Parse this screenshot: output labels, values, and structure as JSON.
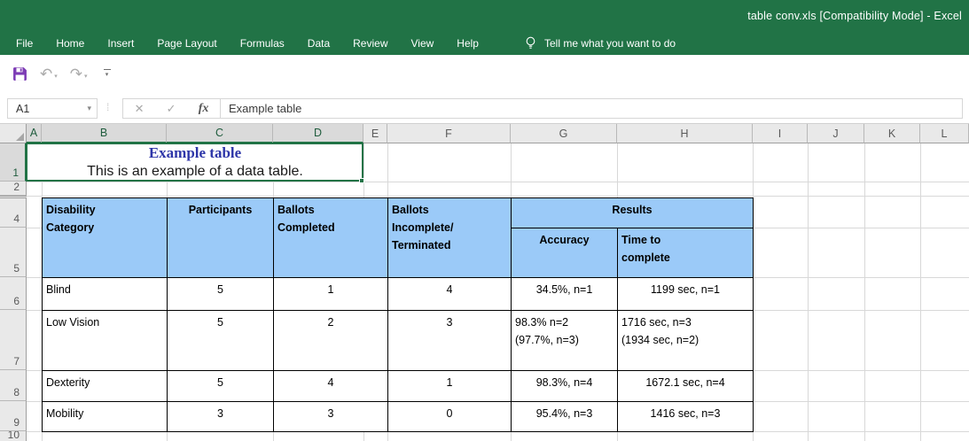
{
  "titlebar": {
    "title": "table conv.xls  [Compatibility Mode]  -  Excel"
  },
  "ribbon": {
    "tabs": [
      "File",
      "Home",
      "Insert",
      "Page Layout",
      "Formulas",
      "Data",
      "Review",
      "View",
      "Help"
    ],
    "tell_me": "Tell me what you want to do"
  },
  "formula_bar": {
    "name_box": "A1",
    "fx_label": "fx",
    "cancel_glyph": "✕",
    "enter_glyph": "✓",
    "formula": "Example table"
  },
  "sheet": {
    "columns": [
      "A",
      "B",
      "C",
      "D",
      "E",
      "F",
      "G",
      "H",
      "I",
      "J",
      "K",
      "L"
    ],
    "rows": [
      "1",
      "2",
      "4",
      "5",
      "6",
      "7",
      "8",
      "9",
      "10"
    ],
    "title_cell": {
      "title": "Example table",
      "subtitle": "This is an example of a data table."
    },
    "table": {
      "headers": {
        "disability": "Disability\nCategory",
        "participants": "Participants",
        "ballots_completed": "Ballots\nCompleted",
        "ballots_incomplete": "Ballots\nIncomplete/\nTerminated",
        "results": "Results",
        "accuracy": "Accuracy",
        "time": "Time to\ncomplete"
      },
      "rows": [
        {
          "category": "Blind",
          "participants": "5",
          "completed": "1",
          "incomplete": "4",
          "accuracy": "34.5%, n=1",
          "time": "1199 sec, n=1"
        },
        {
          "category": "Low Vision",
          "participants": "5",
          "completed": "2",
          "incomplete": "3",
          "accuracy": "98.3% n=2\n(97.7%, n=3)",
          "time": "1716 sec, n=3\n(1934 sec, n=2)"
        },
        {
          "category": "Dexterity",
          "participants": "5",
          "completed": "4",
          "incomplete": "1",
          "accuracy": "98.3%, n=4",
          "time": "1672.1 sec, n=4"
        },
        {
          "category": "Mobility",
          "participants": "3",
          "completed": "3",
          "incomplete": "0",
          "accuracy": "95.4%, n=3",
          "time": "1416 sec, n=3"
        }
      ]
    }
  },
  "colors": {
    "accent_green": "#217346",
    "table_header_blue": "#9bcaf8",
    "title_text_blue": "#2d35a8",
    "save_icon_purple": "#7d3cb5"
  }
}
